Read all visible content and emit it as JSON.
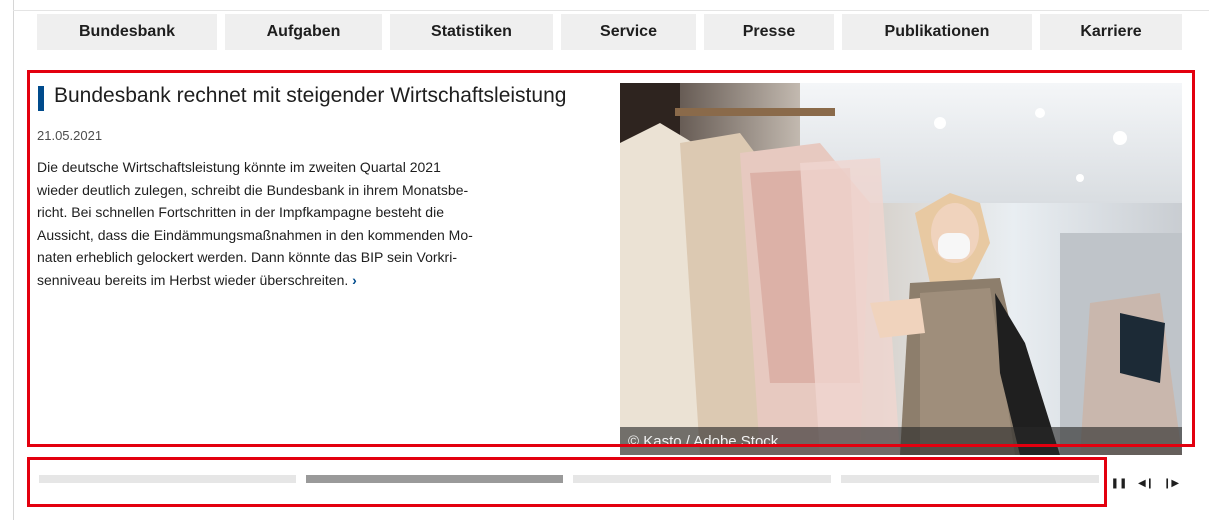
{
  "nav": {
    "items": [
      {
        "label": "Bundesbank"
      },
      {
        "label": "Aufgaben"
      },
      {
        "label": "Statistiken"
      },
      {
        "label": "Service"
      },
      {
        "label": "Presse"
      },
      {
        "label": "Publikationen"
      },
      {
        "label": "Karriere"
      }
    ]
  },
  "teaser": {
    "title": "Bundesbank rechnet mit steigender Wirtschaftsleistung",
    "date": "21.05.2021",
    "lines": [
      "Die deutsche Wirtschaftsleistung könnte im zweiten Quartal 2021",
      "wieder deutlich zulegen, schreibt die Bundesbank in ihrem Monatsbe-",
      "richt. Bei schnellen Fortschritten in der Impfkampagne besteht die",
      "Aussicht, dass die Eindämmungsmaßnahmen in den kommenden Mo-",
      "naten erheblich gelockert werden. Dann könnte das BIP sein Vorkri-",
      "senniveau bereits im Herbst wieder überschreiten."
    ],
    "more_link": "›",
    "image_credit": "© Kasto / Adobe Stock"
  },
  "slider": {
    "active_index": 1,
    "segment_count": 4,
    "controls": {
      "pause": "❚❚",
      "prev": "◀❙",
      "next": "❙▶"
    }
  },
  "colors": {
    "accent": "#004b8c",
    "highlight": "#e3000f",
    "nav_bg": "#efefef"
  }
}
